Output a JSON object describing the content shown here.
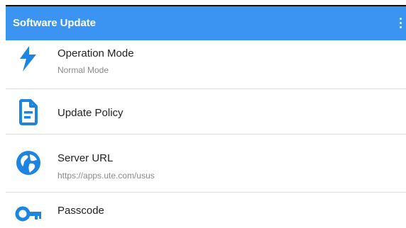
{
  "app": {
    "title": "Software Update"
  },
  "menu": {
    "icon": "more-vert-icon"
  },
  "colors": {
    "accent": "#3b94f2",
    "text": "#222222",
    "subtext": "#8a8a8a",
    "divider": "#dedede",
    "icon": "#1e84e2"
  },
  "settings": {
    "items": [
      {
        "title": "Operation Mode",
        "subtitle": "Normal Mode",
        "icon": "flash-icon"
      },
      {
        "title": "Update Policy",
        "icon": "document-icon"
      },
      {
        "title": "Server URL",
        "subtitle": "https://apps.ute.com/usus",
        "icon": "globe-icon"
      },
      {
        "title": "Passcode",
        "icon": "key-icon"
      }
    ]
  }
}
